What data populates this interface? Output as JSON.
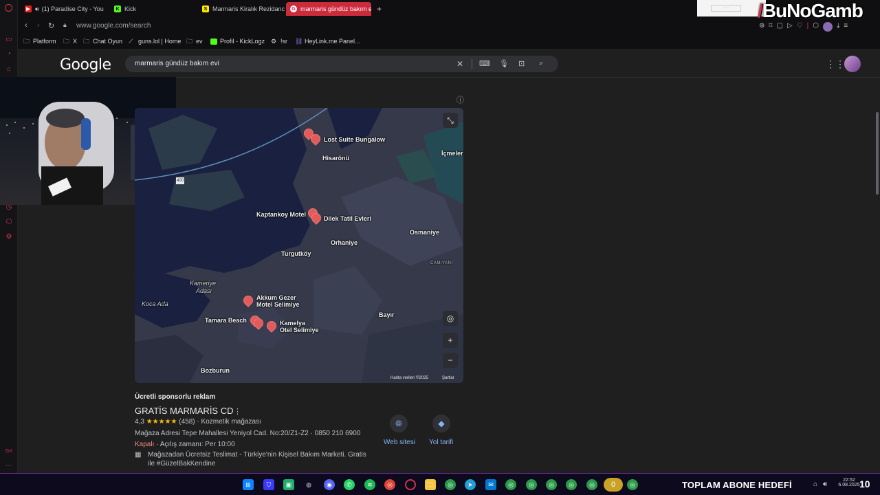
{
  "tabs": [
    {
      "label": "(1) Paradise City - You",
      "icon": "youtube-icon",
      "active": false
    },
    {
      "label": "Kick",
      "icon": "kick-icon",
      "active": false
    },
    {
      "label": "Marmaris Kiralık Rezidanс",
      "icon": "sahibinden-icon",
      "active": false
    },
    {
      "label": "marmaris gündüz bakım e",
      "icon": "google-icon",
      "active": true
    }
  ],
  "address": {
    "url": "www.google.com/search"
  },
  "bookmarks": [
    {
      "label": "Platform",
      "icon": "folder-icon"
    },
    {
      "label": "X",
      "icon": "folder-icon"
    },
    {
      "label": "Chat Oyun",
      "icon": "folder-icon"
    },
    {
      "label": "guns.lol | Home",
      "icon": "gun-icon"
    },
    {
      "label": "ev",
      "icon": "folder-icon"
    },
    {
      "label": "Profil - KickLogz",
      "icon": "kick-icon"
    },
    {
      "label": "!sr",
      "icon": "gear-icon"
    },
    {
      "label": "HeyLink.me Panel...",
      "icon": "link-icon"
    }
  ],
  "stream_logo": {
    "part1": "B",
    "part2": "uNoGamb"
  },
  "google": {
    "logo": "Google",
    "query": "marmaris gündüz bakım evi"
  },
  "map": {
    "places": [
      {
        "label": "Lost Suite Bungalow"
      },
      {
        "label": "Hisarönü"
      },
      {
        "label": "İçmeler"
      },
      {
        "label": "Kaptankoy Motel"
      },
      {
        "label": "Dilek Tatil Evleri"
      },
      {
        "label": "Orhaniye"
      },
      {
        "label": "Osmaniye"
      },
      {
        "label": "CAMIYANI"
      },
      {
        "label": "Turgutköy"
      },
      {
        "label": "Kameriye"
      },
      {
        "label": "Adası"
      },
      {
        "label": "Koca Ada"
      },
      {
        "label": "Akkum Gezer"
      },
      {
        "label": "Motel Selimiye"
      },
      {
        "label": "Tamara Beach"
      },
      {
        "label": "Kamelya"
      },
      {
        "label": "Otel Selimiye"
      },
      {
        "label": "Bayır"
      },
      {
        "label": "Bozburun"
      },
      {
        "label": "400"
      }
    ],
    "attribution": "Harita verileri ©2025",
    "terms": "Şartlar"
  },
  "result": {
    "sponsored": "Ücretli sponsorlu reklam",
    "title": "GRATİS MARMARİS CD",
    "rating": "4,3",
    "stars": "★★★★★",
    "reviews": "(458)",
    "category": "· Kozmetik mağazası",
    "address": "Mağaza Adresi Tepe Mahallesi Yeniyol Cad. No:20/Z1-Z2 · 0850 210 6900",
    "status": "Kapalı",
    "hours": "· Açılış zamanı: Per 10:00",
    "promo_line1": "Mağazadan Ücretsiz Teslimat - Türkiye'nin Kişisel Bakım Marketi. Gratis",
    "promo_line2": "ile #GüzelBakKendine",
    "website_label": "Web sitesi",
    "directions_label": "Yol tarifi"
  },
  "taskbar": {
    "abone_text": "TOPLAM ABONE HEDEFİ",
    "counter": "0",
    "time": "22:52",
    "date": "6.08.2025",
    "day": "10"
  },
  "colors": {
    "accent": "#cc2b3b",
    "taskbar_border": "#6b2a9a",
    "closed": "#f28b82"
  }
}
